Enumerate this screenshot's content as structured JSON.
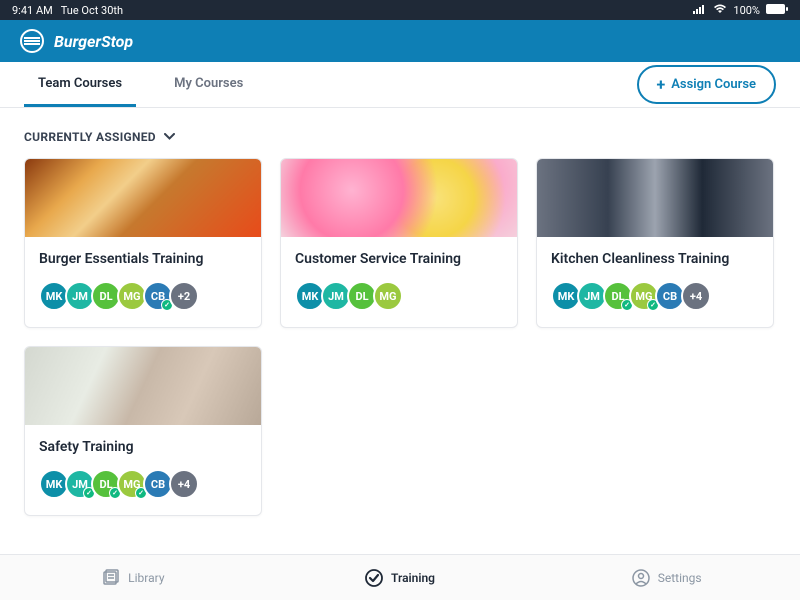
{
  "status_bar": {
    "time": "9:41 AM",
    "date": "Tue Oct 30th",
    "battery": "100%"
  },
  "app": {
    "title": "BurgerStop"
  },
  "tabs": {
    "team": "Team Courses",
    "my": "My Courses"
  },
  "assign_button": "Assign Course",
  "section": {
    "currently_assigned": "CURRENTLY ASSIGNED"
  },
  "courses": [
    {
      "title": "Burger Essentials Training",
      "avatars": [
        {
          "initials": "MK",
          "color": "#0d8fa8",
          "check": false
        },
        {
          "initials": "JM",
          "color": "#1eb7a3",
          "check": false
        },
        {
          "initials": "DL",
          "color": "#56c13c",
          "check": false
        },
        {
          "initials": "MG",
          "color": "#9bc93f",
          "check": false
        },
        {
          "initials": "CB",
          "color": "#2b7bb5",
          "check": true
        },
        {
          "initials": "+2",
          "color": "#6b7280",
          "check": false
        }
      ],
      "imgclass": "img-burger"
    },
    {
      "title": "Customer Service Training",
      "avatars": [
        {
          "initials": "MK",
          "color": "#0d8fa8",
          "check": false
        },
        {
          "initials": "JM",
          "color": "#1eb7a3",
          "check": false
        },
        {
          "initials": "DL",
          "color": "#56c13c",
          "check": false
        },
        {
          "initials": "MG",
          "color": "#9bc93f",
          "check": false
        }
      ],
      "imgclass": "img-balloons"
    },
    {
      "title": "Kitchen Cleanliness Training",
      "avatars": [
        {
          "initials": "MK",
          "color": "#0d8fa8",
          "check": false
        },
        {
          "initials": "JM",
          "color": "#1eb7a3",
          "check": false
        },
        {
          "initials": "DL",
          "color": "#56c13c",
          "check": true
        },
        {
          "initials": "MG",
          "color": "#9bc93f",
          "check": true
        },
        {
          "initials": "CB",
          "color": "#2b7bb5",
          "check": false
        },
        {
          "initials": "+4",
          "color": "#6b7280",
          "check": false
        }
      ],
      "imgclass": "img-kitchen"
    },
    {
      "title": "Safety Training",
      "avatars": [
        {
          "initials": "MK",
          "color": "#0d8fa8",
          "check": false
        },
        {
          "initials": "JM",
          "color": "#1eb7a3",
          "check": true
        },
        {
          "initials": "DL",
          "color": "#56c13c",
          "check": true
        },
        {
          "initials": "MG",
          "color": "#9bc93f",
          "check": true
        },
        {
          "initials": "CB",
          "color": "#2b7bb5",
          "check": false
        },
        {
          "initials": "+4",
          "color": "#6b7280",
          "check": false
        }
      ],
      "imgclass": "img-safety"
    }
  ],
  "bottom_nav": {
    "library": "Library",
    "training": "Training",
    "settings": "Settings"
  }
}
